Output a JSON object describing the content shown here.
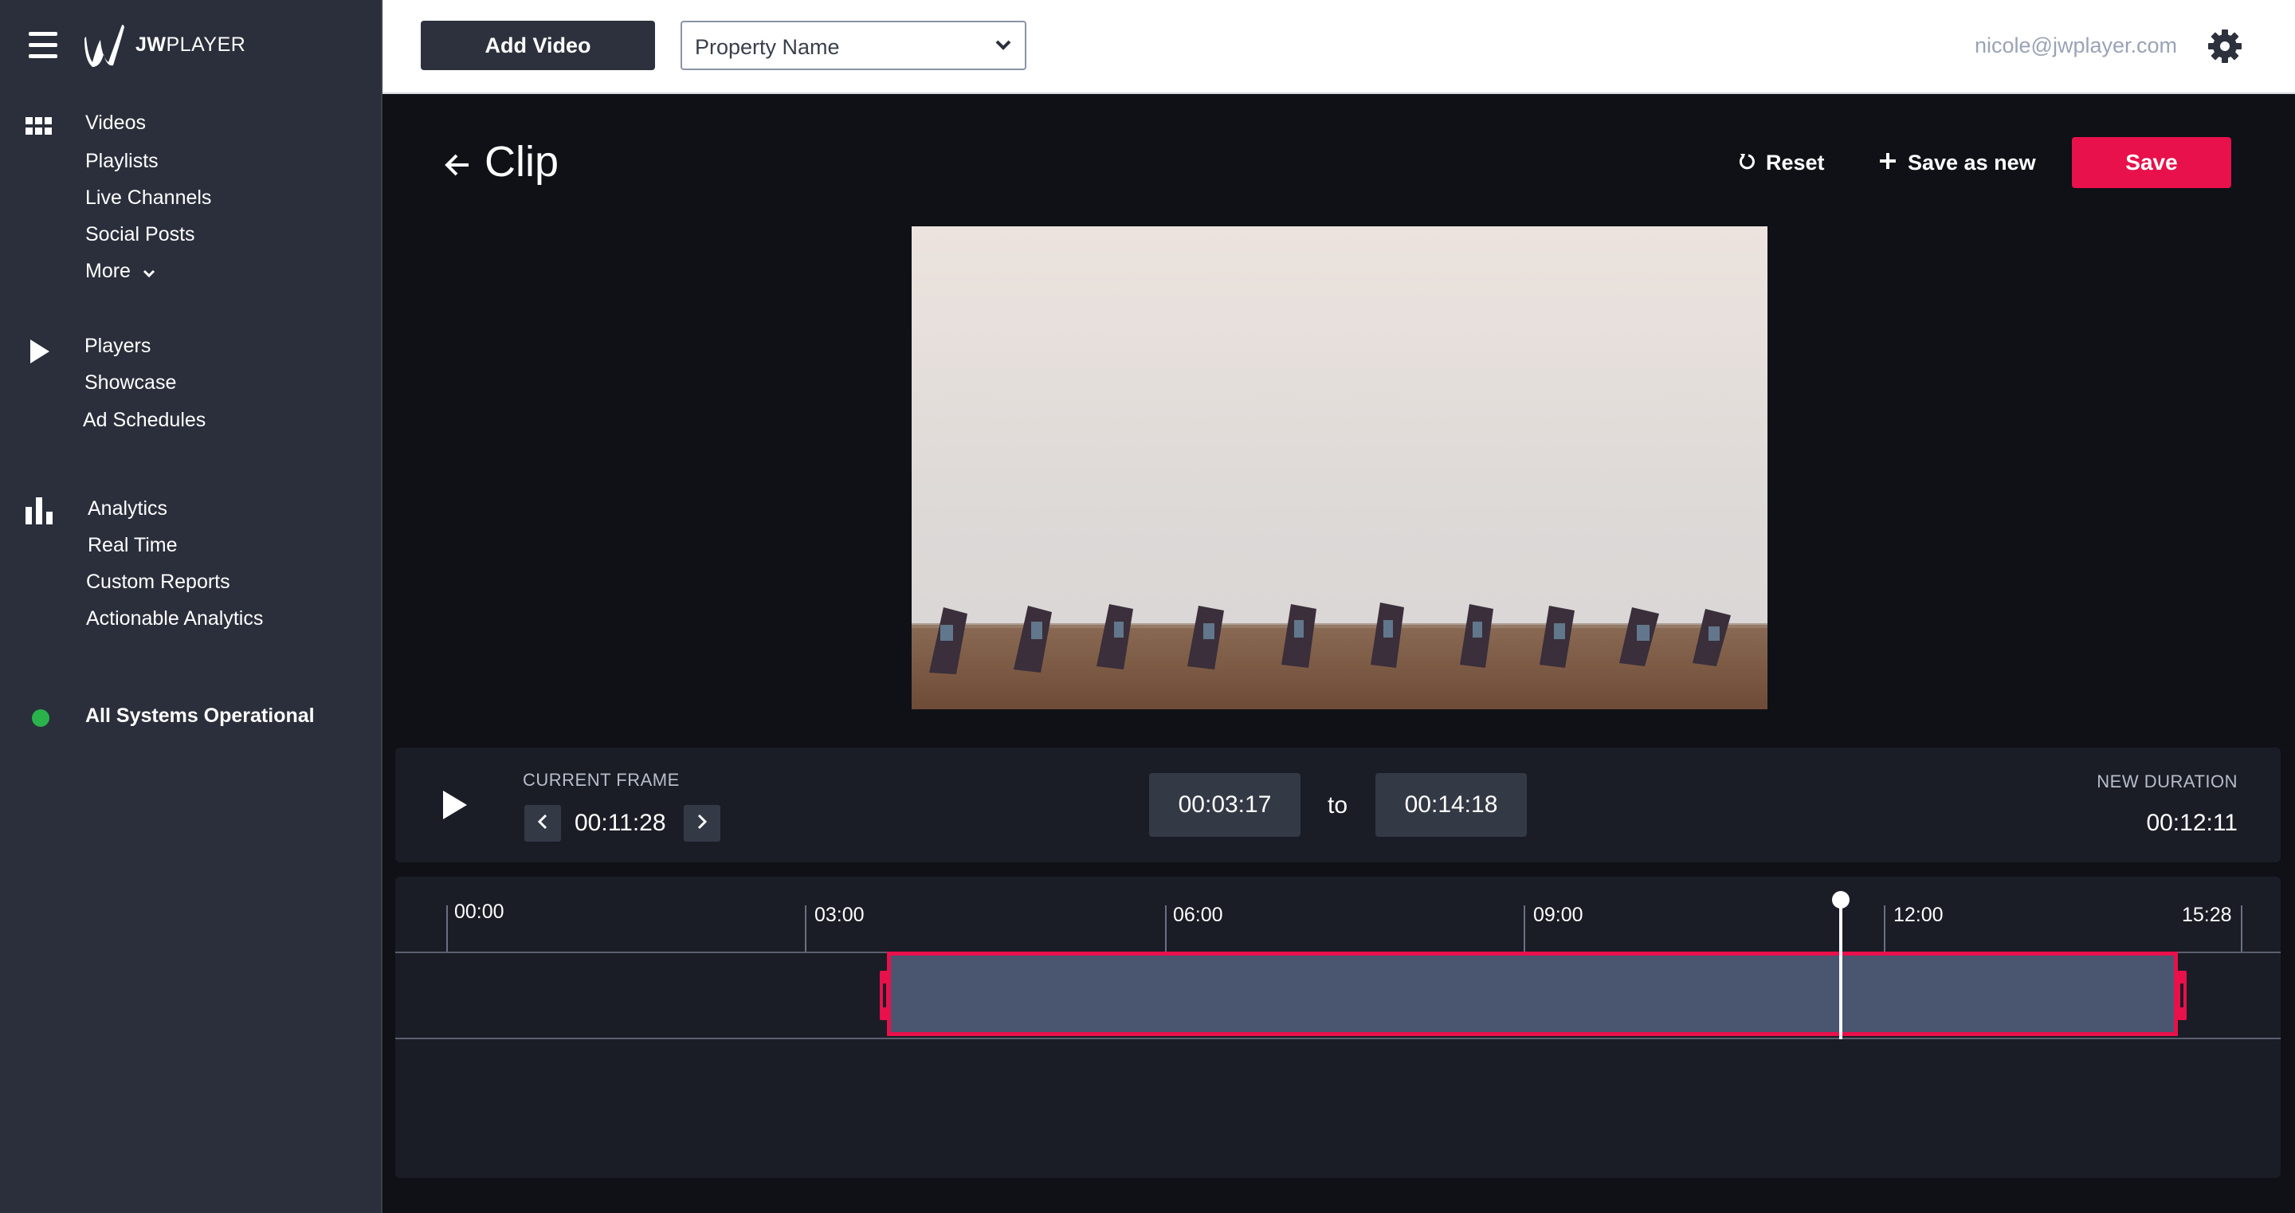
{
  "app": {
    "brand": "JWPLAYER",
    "brand_bold": "JW",
    "brand_rest": "PLAYER"
  },
  "sidebar": {
    "groups": [
      {
        "icon": "grid-icon",
        "items": [
          "Videos",
          "Playlists",
          "Live Channels",
          "Social Posts",
          "More"
        ]
      },
      {
        "icon": "play-icon",
        "items": [
          "Players",
          "Showcase",
          "Ad Schedules"
        ]
      },
      {
        "icon": "bar-chart-icon",
        "items": [
          "Analytics",
          "Real Time",
          "Custom Reports",
          "Actionable Analytics"
        ]
      }
    ],
    "status": {
      "text": "All Systems Operational",
      "color": "#2ab24b"
    }
  },
  "topbar": {
    "add_video_label": "Add Video",
    "property_select": {
      "value": "Property Name"
    },
    "user_email": "nicole@jwplayer.com"
  },
  "clip": {
    "title": "Clip",
    "reset_label": "Reset",
    "save_as_new_label": "Save as new",
    "save_label": "Save",
    "accent_color": "#e8114b"
  },
  "controls": {
    "current_frame_label": "CURRENT FRAME",
    "current_frame_value": "00:11:28",
    "start_time": "00:03:17",
    "to_label": "to",
    "end_time": "00:14:18",
    "new_duration_label": "NEW DURATION",
    "new_duration_value": "00:12:11"
  },
  "timeline": {
    "ticks": [
      "00:00",
      "03:00",
      "06:00",
      "09:00",
      "12:00",
      "15:28"
    ],
    "total_duration": "15:28",
    "clip_start": "00:03:17",
    "clip_end": "00:14:18",
    "playhead": "00:11:28"
  }
}
